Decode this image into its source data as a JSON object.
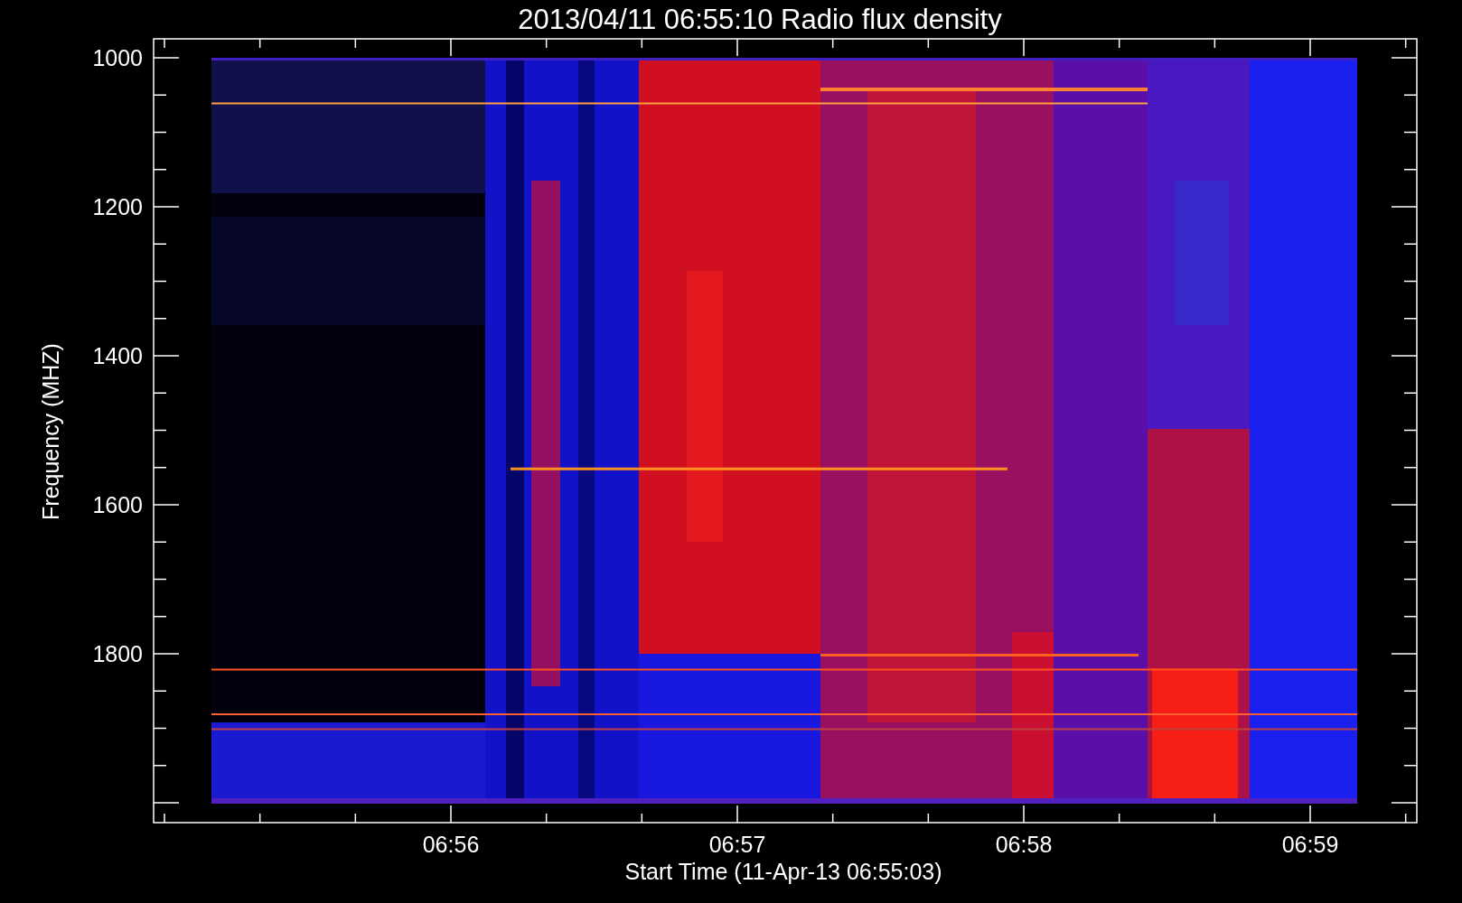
{
  "title": "2013/04/11 06:55:10 Radio flux density",
  "y_axis": {
    "label": "Frequency (MHZ)",
    "ticks": [
      "1000",
      "1200",
      "1400",
      "1600",
      "1800"
    ]
  },
  "x_axis": {
    "label": "Start Time (11-Apr-13 06:55:03)",
    "ticks": [
      "06:56",
      "06:57",
      "06:58",
      "06:59"
    ]
  }
}
